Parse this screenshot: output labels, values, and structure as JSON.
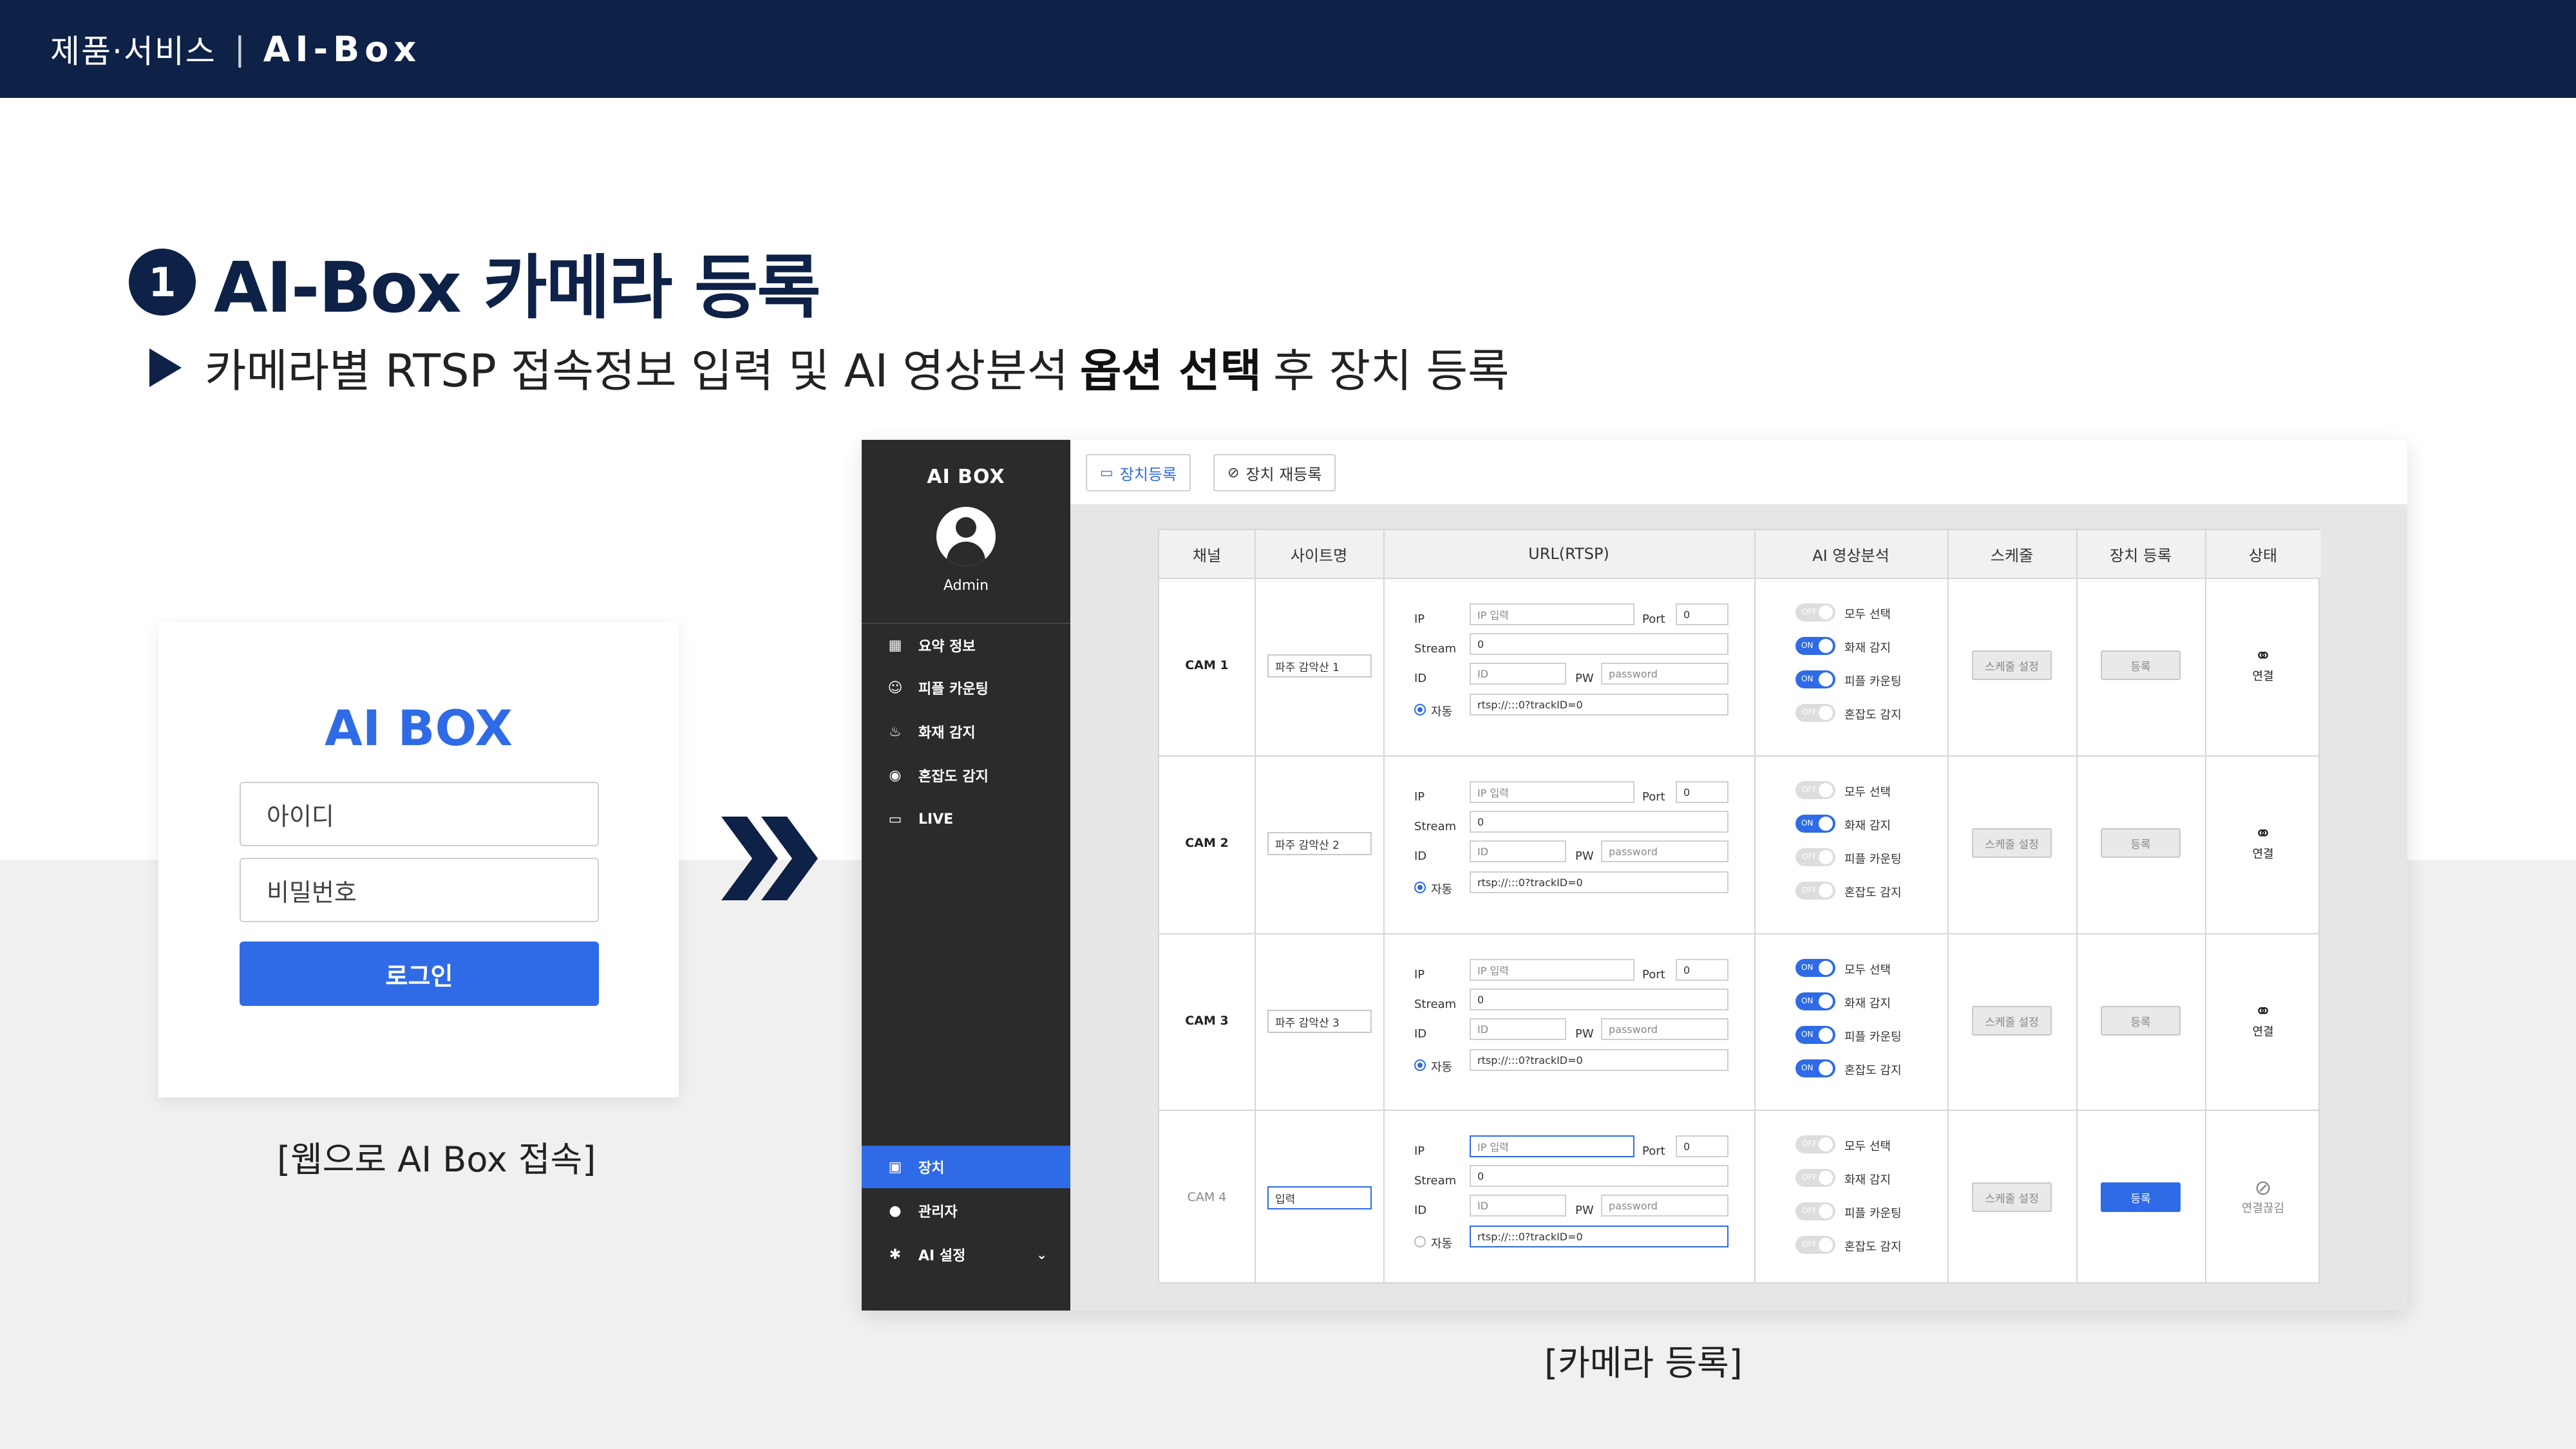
{
  "header": {
    "crumb": "제품·서비스",
    "product": "AI-Box"
  },
  "heading": {
    "number": "1",
    "title": "AI-Box 카메라 등록"
  },
  "subline": {
    "pre": "카메라별 RTSP 접속정보 입력 및 AI 영상분석",
    "bold": "옵션 선택",
    "post": "후 장치 등록"
  },
  "login": {
    "brand": "AI BOX",
    "id_placeholder": "아이디",
    "pw_placeholder": "비밀번호",
    "login_button": "로그인",
    "caption": "[웹으로 AI Box 접속]"
  },
  "app_caption": "[카메라 등록]",
  "sidebar": {
    "logo": "AI BOX",
    "admin": "Admin",
    "menu": [
      {
        "label": "요약 정보",
        "icon": "dashboard-icon"
      },
      {
        "label": "피플 카운팅",
        "icon": "people-icon"
      },
      {
        "label": "화재 감지",
        "icon": "fire-icon"
      },
      {
        "label": "혼잡도 감지",
        "icon": "signal-icon"
      },
      {
        "label": "LIVE",
        "icon": "video-icon"
      }
    ],
    "bottom_menu": [
      {
        "label": "장치",
        "icon": "camera-icon",
        "active": true
      },
      {
        "label": "관리자",
        "icon": "user-icon"
      },
      {
        "label": "AI 설정",
        "icon": "gear-icon"
      }
    ]
  },
  "tabs": [
    {
      "label": "장치등록",
      "icon": "camera-icon",
      "active": true
    },
    {
      "label": "장치 재등록",
      "icon": "camera-off-icon"
    }
  ],
  "table": {
    "headers": [
      "채널",
      "사이트명",
      "URL(RTSP)",
      "AI 영상분석",
      "스케줄",
      "장치 등록",
      "상태"
    ],
    "field_labels": {
      "ip": "IP",
      "port": "Port",
      "stream": "Stream",
      "id": "ID",
      "pw": "PW",
      "auto": "자동"
    },
    "ai_options": [
      "모두 선택",
      "화재 감지",
      "피플 카운팅",
      "혼잡도 감지"
    ],
    "toggle_on": "ON",
    "toggle_off": "OFF",
    "schedule_button": "스케줄 설정",
    "register_button": "등록",
    "rows": [
      {
        "channel": "CAM 1",
        "site": "파주 감악산 1",
        "ip": "IP 입력",
        "port": "0",
        "stream": "0",
        "id": "ID",
        "pw": "password",
        "url": "rtsp://:::0?trackID=0",
        "toggles": [
          false,
          true,
          true,
          false
        ],
        "status": "연결",
        "connected": true,
        "editing": false
      },
      {
        "channel": "CAM 2",
        "site": "파주 감악산 2",
        "ip": "IP 입력",
        "port": "0",
        "stream": "0",
        "id": "ID",
        "pw": "password",
        "url": "rtsp://:::0?trackID=0",
        "toggles": [
          false,
          true,
          false,
          false
        ],
        "status": "연결",
        "connected": true,
        "editing": false
      },
      {
        "channel": "CAM 3",
        "site": "파주 감악산 3",
        "ip": "IP 입력",
        "port": "0",
        "stream": "0",
        "id": "ID",
        "pw": "password",
        "url": "rtsp://:::0?trackID=0",
        "toggles": [
          true,
          true,
          true,
          true
        ],
        "status": "연결",
        "connected": true,
        "editing": false
      },
      {
        "channel": "CAM 4",
        "site": "입력",
        "ip": "IP 입력",
        "port": "0",
        "stream": "0",
        "id": "ID",
        "pw": "password",
        "url": "rtsp://:::0?trackID=0",
        "toggles": [
          false,
          false,
          false,
          false
        ],
        "status": "연결끊김",
        "connected": false,
        "editing": true
      }
    ]
  }
}
